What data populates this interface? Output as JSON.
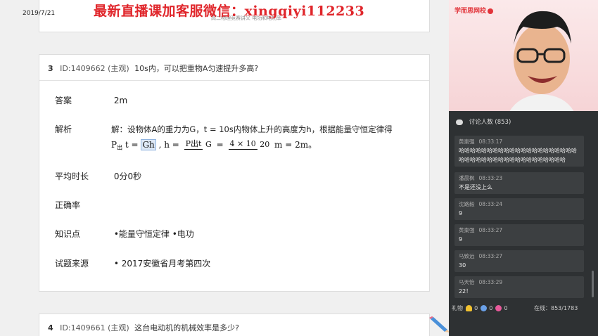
{
  "header": {
    "date": "2019/7/21",
    "watermark": "最新直播课加客服微信：xingqiyi112233",
    "faint_heading": "高二物理竞赛讲义 电功和电功率"
  },
  "questions": [
    {
      "number": "3",
      "id": "ID:1409662",
      "type": "(主观)",
      "text": "10s内，可以把重物A匀速提升多高?",
      "rows": {
        "answer_label": "答案",
        "answer_value": "2m",
        "analysis_label": "解析",
        "analysis_text": "解：设物体A的重力为G，t = 10s内物体上升的高度为h，根据能量守恒定律得",
        "formula": {
          "part1_a": "P",
          "part1_sub": "出",
          "part1_b": "t =",
          "part1_hl": "Gh",
          "part2": ", h =",
          "frac1_num": "P出t",
          "frac1_den": "G",
          "eq": "=",
          "frac2_num": "4 × 10",
          "frac2_den": "20",
          "tail": "m = 2m。"
        },
        "avg_time_label": "平均时长",
        "avg_time_value": "0分0秒",
        "accuracy_label": "正确率",
        "accuracy_value": "",
        "knowledge_label": "知识点",
        "knowledge_value": "•能量守恒定律  •电功",
        "source_label": "试题来源",
        "source_value": "• 2017安徽省月考第四次"
      }
    },
    {
      "number": "4",
      "id": "ID:1409661",
      "type": "(主观)",
      "text": "这台电动机的机械效率是多少?"
    }
  ],
  "panel": {
    "brand": "学而思网校",
    "chat_title": "讨论人数 (853)",
    "messages": [
      {
        "user": "黄棗强",
        "time": "08:33:17",
        "text": "哈哈哈哈哈哈哈哈哈哈哈哈哈哈哈哈哈哈哈哈哈哈哈哈哈哈哈哈哈哈哈哈哈哈哈哈哈哈哈哈"
      },
      {
        "user": "潘晨枫",
        "time": "08:33:23",
        "text": "不是还没上么"
      },
      {
        "user": "沈路毅",
        "time": "08:33:24",
        "text": "9"
      },
      {
        "user": "黄棗强",
        "time": "08:33:27",
        "text": "9"
      },
      {
        "user": "马致远",
        "time": "08:33:27",
        "text": "30"
      },
      {
        "user": "马天怡",
        "time": "08:33:29",
        "text": "22！"
      }
    ],
    "footer": {
      "gift_label": "礼物",
      "count1": "0",
      "count2": "0",
      "count3": "0",
      "online": "在线：853/1783"
    }
  },
  "colors": {
    "watermark": "#e0262b",
    "panel_bg": "#2e3133",
    "highlight": "#dde8f6"
  }
}
